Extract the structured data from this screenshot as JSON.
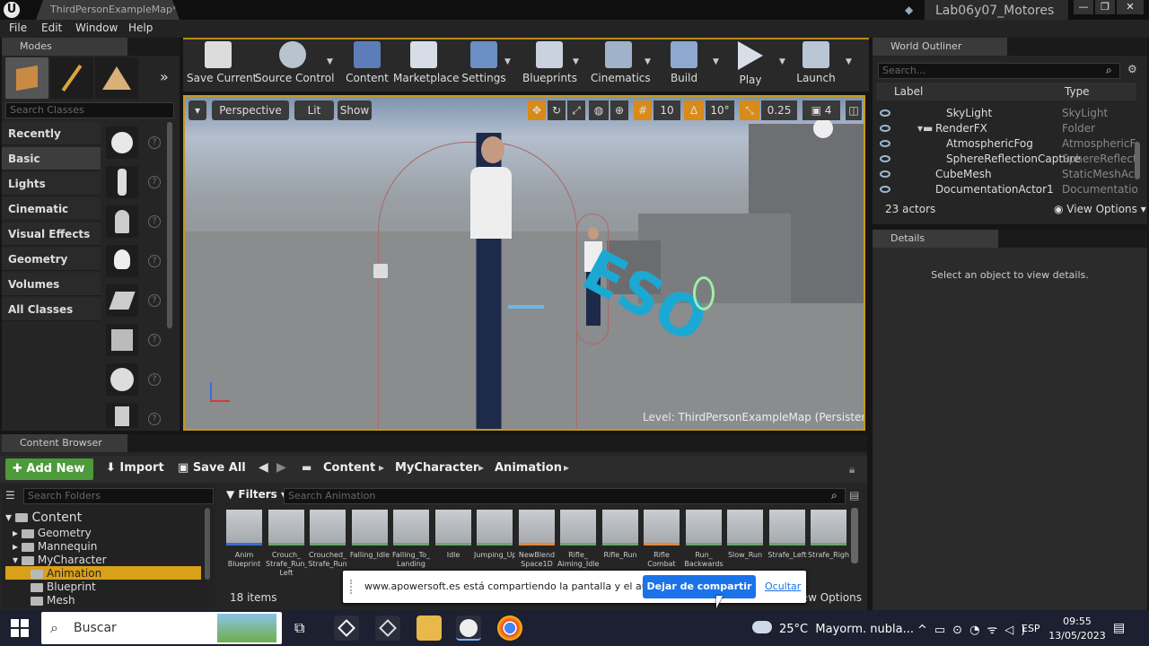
{
  "titlebar": {
    "doc_tab": "ThirdPersonExampleMap*",
    "project": "Lab06y07_Motores"
  },
  "menu": [
    "File",
    "Edit",
    "Window",
    "Help"
  ],
  "modes": {
    "tab": "Modes",
    "search_placeholder": "Search Classes",
    "categories": [
      "Recently Placed",
      "Basic",
      "Lights",
      "Cinematic",
      "Visual Effects",
      "Geometry",
      "Volumes",
      "All Classes"
    ],
    "selected": "Basic"
  },
  "toolbar": {
    "buttons": [
      "Save Current",
      "Source Control",
      "Content",
      "Marketplace",
      "Settings",
      "Blueprints",
      "Cinematics",
      "Build",
      "Play",
      "Launch"
    ]
  },
  "viewport": {
    "perspective": "Perspective",
    "lit": "Lit",
    "show": "Show",
    "grid": "10",
    "angle": "10°",
    "scale": "0.25",
    "speed": "4",
    "level_label": "Level:",
    "level_name": "ThirdPersonExampleMap (Persistent)"
  },
  "outliner": {
    "tab": "World Outliner",
    "search_placeholder": "Search...",
    "col_label": "Label",
    "col_type": "Type",
    "rows": [
      {
        "label": "SkyLight",
        "type": "SkyLight"
      },
      {
        "label": "RenderFX",
        "type": "Folder"
      },
      {
        "label": "AtmosphericFog",
        "type": "AtmosphericFo"
      },
      {
        "label": "SphereReflectionCapture",
        "type": "SphereReflecti"
      },
      {
        "label": "CubeMesh",
        "type": "StaticMeshActo"
      },
      {
        "label": "DocumentationActor1",
        "type": "Documentation"
      }
    ],
    "count": "23 actors",
    "view_options": "View Options"
  },
  "details": {
    "tab": "Details",
    "empty": "Select an object to view details."
  },
  "content_browser": {
    "tab": "Content Browser",
    "add_new": "Add New",
    "import": "Import",
    "save_all": "Save All",
    "path": [
      "Content",
      "MyCharacter",
      "Animation"
    ],
    "search_folders": "Search Folders",
    "filters": "Filters",
    "search_assets": "Search Animation",
    "tree": [
      {
        "name": "Content",
        "level": 0
      },
      {
        "name": "Geometry",
        "level": 1
      },
      {
        "name": "Mannequin",
        "level": 1
      },
      {
        "name": "MyCharacter",
        "level": 1
      },
      {
        "name": "Animation",
        "level": 2
      },
      {
        "name": "Blueprint",
        "level": 2
      },
      {
        "name": "Mesh",
        "level": 2
      }
    ],
    "assets": [
      "Anim\nBlueprint",
      "Crouch_\nStrafe_Run_\nLeft",
      "Crouched_\nStrafe_Run",
      "Falling_Idle",
      "Falling_To_\nLanding",
      "Idle",
      "Jumping_Up",
      "NewBlend\nSpace1D",
      "Rifle_\nAiming_Idle",
      "Rifle_Run",
      "Rifle\nCombat",
      "Run_\nBackwards",
      "Slow_Run",
      "Strafe_Left",
      "Strafe_Right"
    ],
    "item_count": "18 items",
    "view_options": "View Options"
  },
  "share_bar": {
    "text": "www.apowersoft.es está compartiendo la pantalla y el audio.",
    "stop": "Dejar de compartir",
    "hide": "Ocultar"
  },
  "taskbar": {
    "search": "Buscar",
    "weather": "25°C  Mayorm. nubla...",
    "lang": "ESP",
    "time": "09:55",
    "date": "13/05/2023"
  }
}
